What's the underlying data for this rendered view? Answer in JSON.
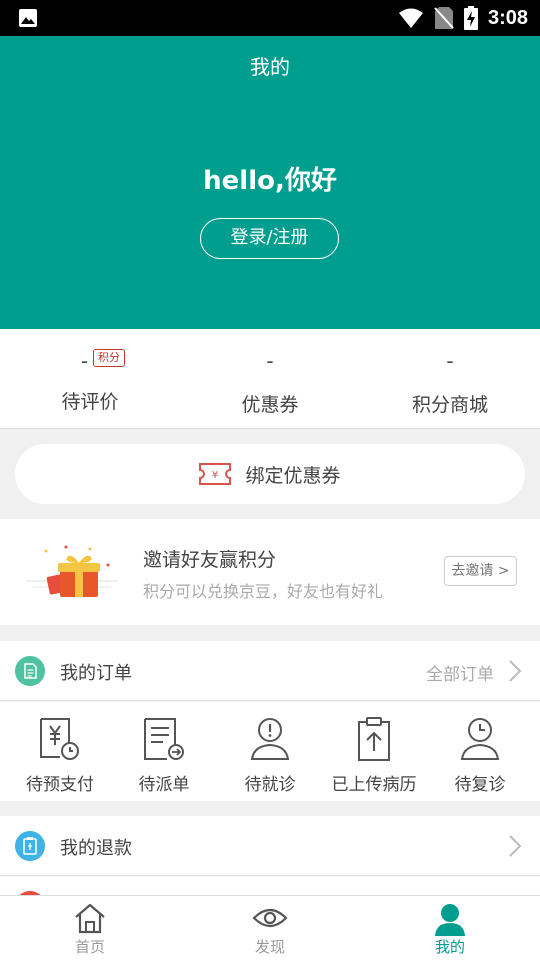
{
  "status_bar": {
    "time": "3:08"
  },
  "header": {
    "title": "我的",
    "greeting": "hello,你好",
    "login_button": "登录/注册"
  },
  "stats": [
    {
      "value": "-",
      "label": "待评价",
      "badge": "积分"
    },
    {
      "value": "-",
      "label": "优惠券"
    },
    {
      "value": "-",
      "label": "积分商城"
    }
  ],
  "coupon_button": {
    "label": "绑定优惠券",
    "icon_glyph": "¥"
  },
  "invite": {
    "title": "邀请好友赢积分",
    "subtitle": "积分可以兑换京豆，好友也有好礼",
    "button": "去邀请 >"
  },
  "orders": {
    "title": "我的订单",
    "view_all": "全部订单",
    "items": [
      {
        "label": "待预支付"
      },
      {
        "label": "待派单"
      },
      {
        "label": "待就诊"
      },
      {
        "label": "已上传病历"
      },
      {
        "label": "待复诊"
      }
    ]
  },
  "refund": {
    "title": "我的退款"
  },
  "tabs": [
    {
      "label": "首页"
    },
    {
      "label": "发现"
    },
    {
      "label": "我的",
      "active": true
    }
  ],
  "colors": {
    "brand": "#009e8f",
    "badge": "#c0392b",
    "order_icon": "#4fc3a1",
    "refund_icon": "#3db3e6"
  }
}
